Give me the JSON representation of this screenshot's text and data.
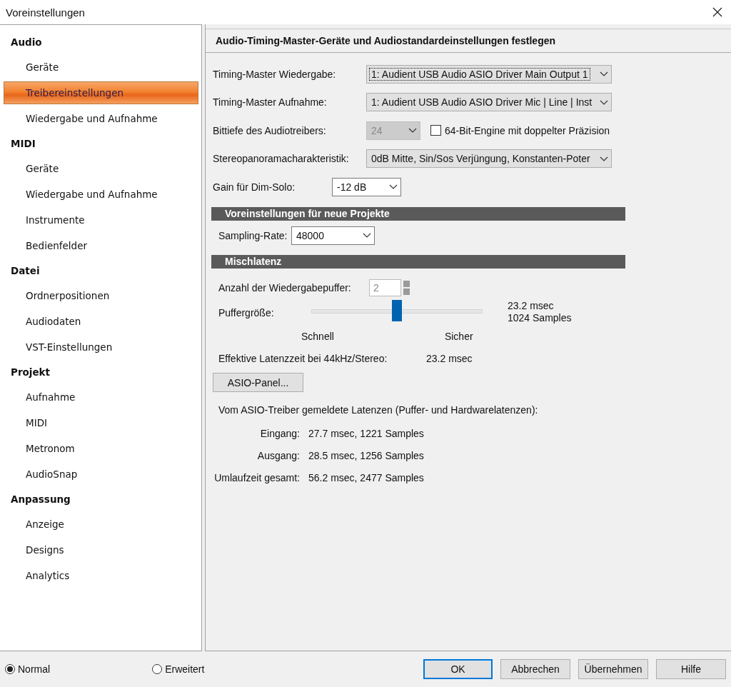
{
  "window": {
    "title": "Voreinstellungen"
  },
  "sidebar": {
    "groups": [
      {
        "label": "Audio",
        "items": [
          {
            "label": "Geräte",
            "selected": false
          },
          {
            "label": "Treibereinstellungen",
            "selected": true
          },
          {
            "label": "Wiedergabe und Aufnahme",
            "selected": false
          }
        ]
      },
      {
        "label": "MIDI",
        "items": [
          {
            "label": "Geräte",
            "selected": false
          },
          {
            "label": "Wiedergabe und Aufnahme",
            "selected": false
          },
          {
            "label": "Instrumente",
            "selected": false
          },
          {
            "label": "Bedienfelder",
            "selected": false
          }
        ]
      },
      {
        "label": "Datei",
        "items": [
          {
            "label": "Ordnerpositionen",
            "selected": false
          },
          {
            "label": "Audiodaten",
            "selected": false
          },
          {
            "label": "VST-Einstellungen",
            "selected": false
          }
        ]
      },
      {
        "label": "Projekt",
        "items": [
          {
            "label": "Aufnahme",
            "selected": false
          },
          {
            "label": "MIDI",
            "selected": false
          },
          {
            "label": "Metronom",
            "selected": false
          },
          {
            "label": "AudioSnap",
            "selected": false
          }
        ]
      },
      {
        "label": "Anpassung",
        "items": [
          {
            "label": "Anzeige",
            "selected": false
          },
          {
            "label": "Designs",
            "selected": false
          },
          {
            "label": "Analytics",
            "selected": false
          }
        ]
      }
    ]
  },
  "panel": {
    "heading": "Audio-Timing-Master-Geräte und Audiostandardeinstellungen festlegen",
    "timing_playback": {
      "label": "Timing-Master Wiedergabe:",
      "value": "1: Audient USB Audio ASIO Driver Main Output 1",
      "focused": true
    },
    "timing_record": {
      "label": "Timing-Master Aufnahme:",
      "value": "1: Audient USB Audio ASIO Driver Mic | Line | Inst"
    },
    "bit_depth": {
      "label": "Bittiefe des Audiotreibers:",
      "value": "24",
      "disabled": true
    },
    "engine_64bit": {
      "label": "64-Bit-Engine mit doppelter Präzision",
      "checked": false
    },
    "pan_law": {
      "label": "Stereopanoramacharakteristik:",
      "value": "0dB Mitte, Sin/Sos Verjüngung, Konstanten-Poter"
    },
    "dim_solo": {
      "label": "Gain für Dim-Solo:",
      "value": "-12 dB"
    },
    "new_projects": {
      "title": "Voreinstellungen für neue Projekte",
      "sampling": {
        "label": "Sampling-Rate:",
        "value": "48000"
      }
    },
    "mix_latency": {
      "title": "Mischlatenz",
      "buffers": {
        "label": "Anzahl der Wiedergabepuffer:",
        "value": "2"
      },
      "buffer_size": {
        "label": "Puffergröße:",
        "level": 0.5,
        "reading_time": "23.2 msec",
        "reading_samples": "1024 Samples",
        "min_label": "Schnell",
        "max_label": "Sicher"
      },
      "effective": {
        "label": "Effektive Latenzzeit bei 44kHz/Stereo:",
        "value": "23.2 msec"
      },
      "asio_button": "ASIO-Panel...",
      "reported_title": "Vom ASIO-Treiber gemeldete Latenzen (Puffer- und Hardwarelatenzen):",
      "reported": [
        {
          "label": "Eingang:",
          "value": "27.7 msec, 1221 Samples"
        },
        {
          "label": "Ausgang:",
          "value": "28.5 msec, 1256 Samples"
        },
        {
          "label": "Umlaufzeit gesamt:",
          "value": "56.2 msec, 2477 Samples"
        }
      ]
    }
  },
  "footer": {
    "modes": [
      {
        "label": "Normal",
        "selected": true
      },
      {
        "label": "Erweitert",
        "selected": false
      }
    ],
    "buttons": [
      {
        "label": "OK",
        "default": true
      },
      {
        "label": "Abbrechen",
        "default": false
      },
      {
        "label": "Übernehmen",
        "default": false
      },
      {
        "label": "Hilfe",
        "default": false
      }
    ]
  }
}
